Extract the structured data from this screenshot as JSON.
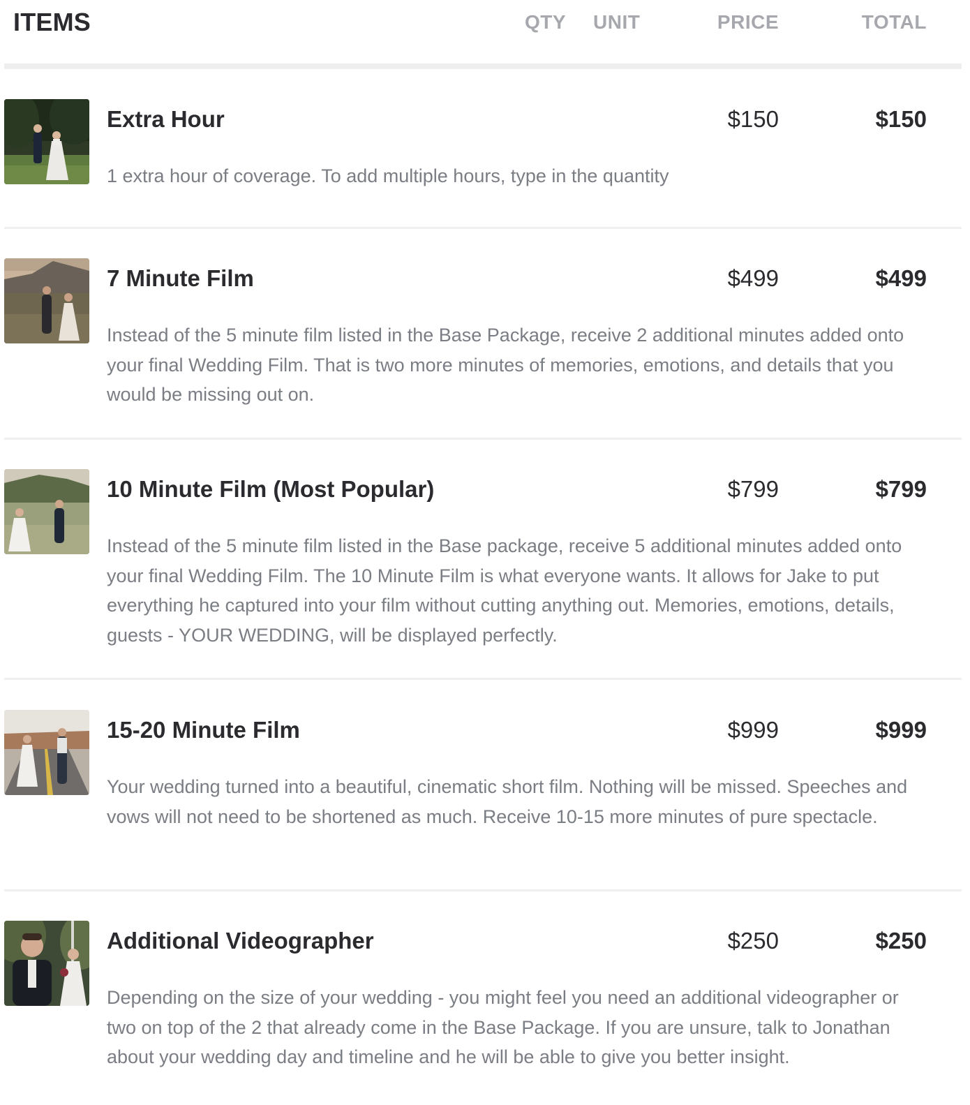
{
  "header": {
    "title": "ITEMS",
    "columns": {
      "qty": "QTY",
      "unit": "UNIT",
      "price": "PRICE",
      "total": "TOTAL"
    }
  },
  "items": [
    {
      "name": "Extra Hour",
      "price": "$150",
      "total": "$150",
      "description": "1 extra hour of coverage. To add multiple hours, type in the quantity",
      "thumbnail": "couple-in-meadow-photo"
    },
    {
      "name": "7 Minute Film",
      "price": "$499",
      "total": "$499",
      "description": "Instead of the 5 minute film listed in the Base Package, receive 2 additional minutes added onto your final Wedding Film. That is two more minutes of memories, emotions, and details that you would be missing out on.",
      "thumbnail": "couple-at-sunset-photo"
    },
    {
      "name": "10 Minute Film (Most Popular)",
      "price": "$799",
      "total": "$799",
      "description": "Instead of the 5 minute film listed in the Base package, receive 5 additional minutes added onto your final Wedding Film. The 10 Minute Film is what everyone wants. It allows for Jake to put everything he captured into your film without cutting anything out. Memories, emotions, details, guests - YOUR WEDDING, will be displayed perfectly.",
      "thumbnail": "couple-walking-field-photo"
    },
    {
      "name": "15-20 Minute Film",
      "price": "$999",
      "total": "$999",
      "description": "Your wedding turned into a beautiful, cinematic short film. Nothing will be missed. Speeches and vows will not need to be shortened as much. Receive 10-15 more minutes of pure spectacle.",
      "thumbnail": "couple-on-road-photo"
    },
    {
      "name": "Additional Videographer",
      "price": "$250",
      "total": "$250",
      "description": "Depending on the size of your wedding - you might feel you need an additional videographer or two on top of the 2 that already come in the Base Package. If you are unsure, talk to Jonathan about your wedding day and timeline and he will be able to give you better insight.",
      "thumbnail": "groom-and-bride-portrait-photo"
    }
  ]
}
